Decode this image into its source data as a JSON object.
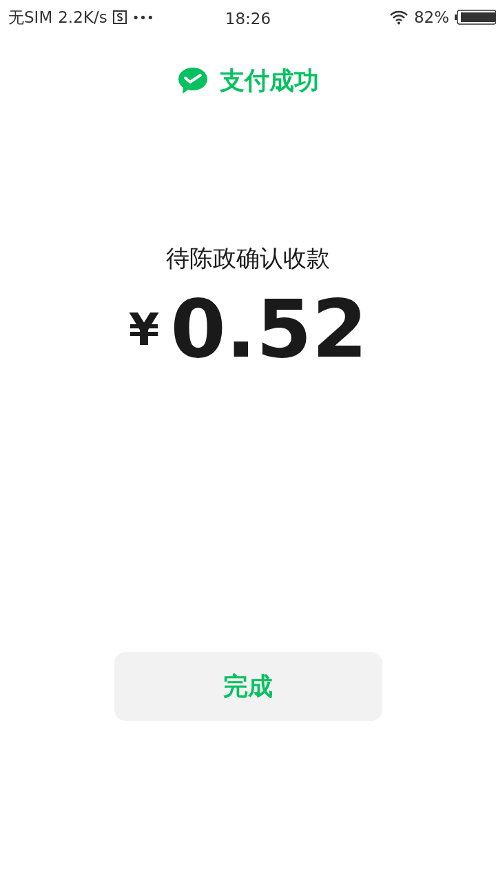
{
  "status_bar": {
    "carrier": "无SIM",
    "speed": "2.2K/s",
    "dots": "•••",
    "time": "18:26",
    "battery": "82%"
  },
  "header": {
    "title": "支付成功"
  },
  "payment": {
    "message": "待陈政确认收款",
    "currency": "¥",
    "amount": "0.52"
  },
  "buttons": [
    "完成"
  ]
}
